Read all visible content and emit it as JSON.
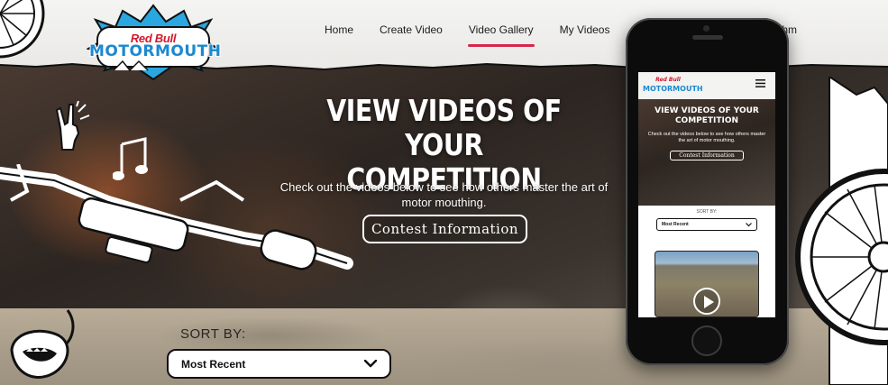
{
  "logo": {
    "brand_top": "Red Bull",
    "brand_main": "MOTORMOUTH"
  },
  "nav": {
    "items": [
      {
        "label": "Home"
      },
      {
        "label": "Create Video"
      },
      {
        "label": "Video Gallery",
        "active": true
      },
      {
        "label": "My Videos"
      }
    ],
    "partial_right": "ythm",
    "active_color": "#d8264a"
  },
  "hero": {
    "title_line1": "VIEW VIDEOS OF YOUR",
    "title_line2": "COMPETITION",
    "subtitle": "Check out the videos below to see how others master the art of motor mouthing.",
    "button": "Contest Information"
  },
  "sort": {
    "label": "SORT BY:",
    "selected": "Most Recent",
    "icon": "chevron-down-icon"
  },
  "phone": {
    "logo_top": "Red Bull",
    "logo_main": "MOTORMOUTH",
    "title_line1": "VIEW VIDEOS OF YOUR",
    "title_line2": "COMPETITION",
    "subtitle": "Check out the videos below to see how others master the art of motor mouthing.",
    "button": "Contest Information",
    "sort_label": "SORT BY:",
    "sort_selected": "Most Recent",
    "icons": [
      "hamburger-menu-icon",
      "play-icon"
    ]
  }
}
